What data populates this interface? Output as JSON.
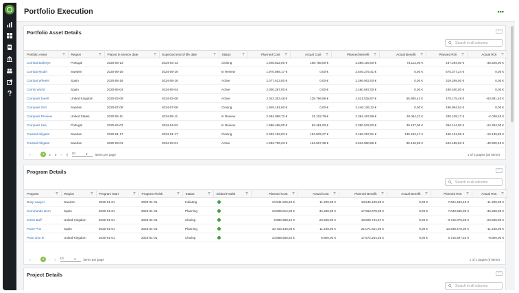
{
  "page": {
    "title": "Portfolio Execution"
  },
  "sidebar": {
    "icons": [
      "chart-bar-icon",
      "dashboard-grid-icon",
      "document-icon",
      "bank-icon",
      "users-icon",
      "export-icon",
      "help-icon"
    ]
  },
  "asset_panel": {
    "title": "Portfolio Asset Details",
    "search_placeholder": "Search in all columns",
    "columns": [
      "Portfolio Asset",
      "Region",
      "Placed in service date",
      "Expected end of life date",
      "Status",
      "Planned Cost",
      "Actual Cost",
      "Planned Benefit",
      "Actual Benefit",
      "Planned ROI",
      "Actual ROI"
    ],
    "rows": [
      [
        "Combat Bullseye",
        "Portugal",
        "2020-03-13",
        "2024-03-13",
        "Closing",
        "1.948.822,00 €",
        "108.758,00 €",
        "2.386.106,00 €",
        "75.112,00 €",
        "437.284,00 €",
        "-33.626,00 €"
      ],
      [
        "Combat Model",
        "Sweden",
        "2020-09-19",
        "2024-09-19",
        "In Review",
        "1.970.898,17 €",
        "0,00 €",
        "2.546.275,41 €",
        "0,00 €",
        "575.377,24 €",
        "0,00 €"
      ],
      [
        "Combat Wheels",
        "Spain",
        "2020-08-18",
        "2024-08-18",
        "Active",
        "2.077.613,00 €",
        "0,00 €",
        "2.396.902,00 €",
        "0,00 €",
        "319.289,00 €",
        "0,00 €"
      ],
      [
        "Comfy World",
        "Spain",
        "2020-06-04",
        "2024-06-04",
        "Active",
        "2.000.287,00 €",
        "0,00 €",
        "2.460.687,00 €",
        "0,00 €",
        "460.400,00 €",
        "0,00 €"
      ],
      [
        "Compass Dwell",
        "United Kingdom",
        "2020-02-08",
        "2024-02-08",
        "Active",
        "2.043.363,48 €",
        "129.796,96 €",
        "2.521.538,97 €",
        "65.905,43 €",
        "478.175,49 €",
        "-63.891,52 €"
      ],
      [
        "Compass Owl",
        "Sweden",
        "2020-07-08",
        "2024-07-08",
        "Closing",
        "1.949.161,60 €",
        "0,00 €",
        "2.446.136,12 €",
        "0,00 €",
        "496.984,52 €",
        "0,00 €"
      ],
      [
        "Compass Preview",
        "United States",
        "2020-05-11",
        "2024-05-11",
        "In Review",
        "2.054.088,72 €",
        "31.102,78 €",
        "2.384.467,89 €",
        "29.064,22 €",
        "330.109,17 €",
        "-2.038,53 €"
      ],
      [
        "Compass Sea",
        "Portugal",
        "2020-04-02",
        "2024-04-02",
        "In Review",
        "1.986.488,00 €",
        "63.481,00 €",
        "2.350.632,00 €",
        "39.187,00 €",
        "364.144,00 €",
        "-24.294,00 €"
      ],
      [
        "Crested Alligator",
        "Sweden",
        "2020-01-17",
        "2024-01-17",
        "Closing",
        "2.002.163,03 €",
        "154.602,27 €",
        "2.462.297,61 €",
        "135.462,47 €",
        "460.134,58 €",
        "-19.139,80 €"
      ],
      [
        "Crested Alligator",
        "Sweden",
        "2020-03-01",
        "2024-03-01",
        "Active",
        "1.992.796,23 €",
        "124.027,38 €",
        "2.534.980,86 €",
        "85.126,98 €",
        "542.185,63 €",
        "-40.900,40 €"
      ]
    ],
    "pager": {
      "pages": [
        "1",
        "2",
        "3"
      ],
      "page_size": "10",
      "items_label": "items per page",
      "info": "1 of 3 pages (30 items)"
    }
  },
  "program_panel": {
    "title": "Program Details",
    "search_placeholder": "Search in all columns",
    "columns": [
      "Program",
      "Region",
      "Program Start",
      "Program Finish",
      "Status",
      "Global Health",
      "Planned Cost",
      "Actual Cost",
      "Planned Benefit",
      "Actual Benefit",
      "Planned ROI",
      "Actual ROI"
    ],
    "rows": [
      [
        "Busy Lawyer",
        "Sweden",
        "2020-01-01",
        "2023-01-01",
        "Initiating",
        "green",
        "10.941.626,50 €",
        "11.200,00 €",
        "18.546.109,89 €",
        "0,00 €",
        "7.604.482,40 €",
        "-11.200,00 €"
      ],
      [
        "Commando Dern",
        "Spain",
        "2020-01-01",
        "2023-01-01",
        "Planning",
        "green",
        "10.509.812,00 €",
        "34.280,00 €",
        "17.553.678,00 €",
        "0,00 €",
        "7.043.866,00 €",
        "-34.280,00 €"
      ],
      [
        "Creek Buff",
        "United Kingdom",
        "2020-01-01",
        "2023-01-01",
        "Closing",
        "green",
        "9.984.668,22 €",
        "23.840,00 €",
        "18.600.744,57 €",
        "0,00 €",
        "8.716.076,35 €",
        "-23.840,00 €"
      ],
      [
        "Pacer Pox",
        "Spain",
        "2020-01-01",
        "2023-01-01",
        "Planning",
        "green",
        "10.723.146,00 €",
        "11.440,00 €",
        "21.071.621,00 €",
        "0,00 €",
        "10.348.475,00 €",
        "-11.440,00 €"
      ],
      [
        "Pave Lion III",
        "United Kingdom",
        "2020-01-01",
        "2023-01-01",
        "Closing",
        "green",
        "10.858.556,82 €",
        "8.800,00 €",
        "17.572.254,35 €",
        "0,00 €",
        "6.716.697,53 €",
        "-8.800,00 €"
      ]
    ],
    "pager": {
      "pages": [
        "1"
      ],
      "page_size": "10",
      "items_label": "items per page",
      "info": "1 of 1 pages (5 items)"
    }
  },
  "project_panel": {
    "title": "Project Details",
    "search_placeholder": "Search in all columns"
  },
  "colors": {
    "accent": "#8bc34a",
    "health_ok": "#43a047",
    "link": "#2f6fb3",
    "sidebar": "#1b1e22"
  }
}
